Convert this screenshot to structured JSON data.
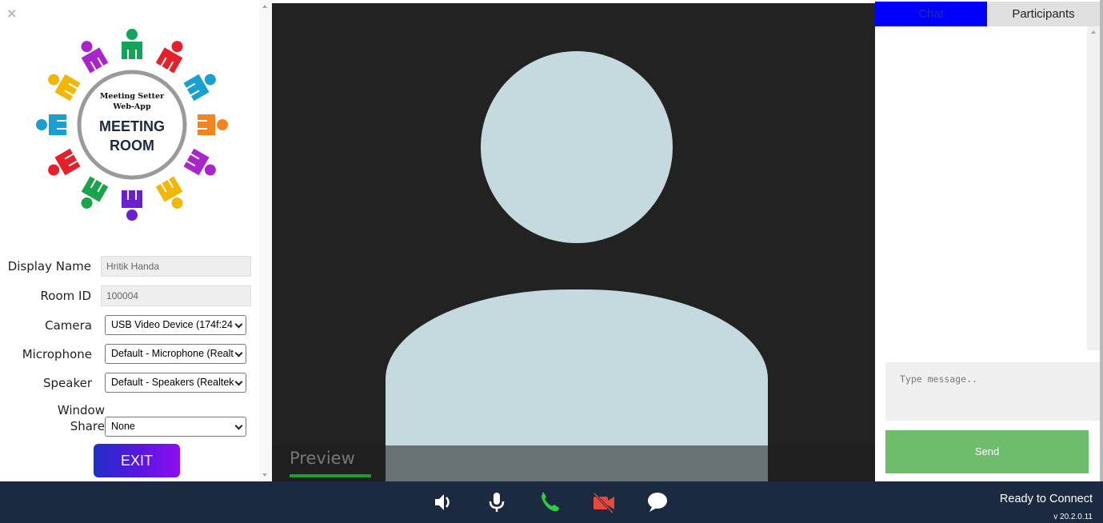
{
  "window": {
    "close_symbol": "×"
  },
  "logo": {
    "line1": "Meeting Setter",
    "line2": "Web-App",
    "title1": "MEETING",
    "title2": "ROOM"
  },
  "form": {
    "display_name_label": "Display Name",
    "display_name_value": "Hritik Handa",
    "room_id_label": "Room ID",
    "room_id_value": "100004",
    "camera_label": "Camera",
    "camera_value": "USB Video Device (174f:24",
    "microphone_label": "Microphone",
    "microphone_value": "Default - Microphone (Realt",
    "speaker_label": "Speaker",
    "speaker_value": "Default - Speakers (Realtek",
    "window_share_label_1": "Window",
    "window_share_label_2": "Share",
    "window_share_value": "None",
    "exit_label": "EXIT"
  },
  "video": {
    "preview_label": "Preview"
  },
  "chat": {
    "tab_chat": "Chat",
    "tab_participants": "Participants",
    "message_placeholder": "Type message..",
    "send_label": "Send"
  },
  "bottom": {
    "status": "Ready to Connect",
    "version": "v 20.2.0.11"
  },
  "colors": {
    "chat_tab_active": "#0000ff",
    "send_button": "#6dbd6d",
    "bottom_bar": "#1b2a40",
    "call_icon": "#2ecc40",
    "video_off_icon": "#e8483a",
    "avatar": "#c4dade"
  }
}
